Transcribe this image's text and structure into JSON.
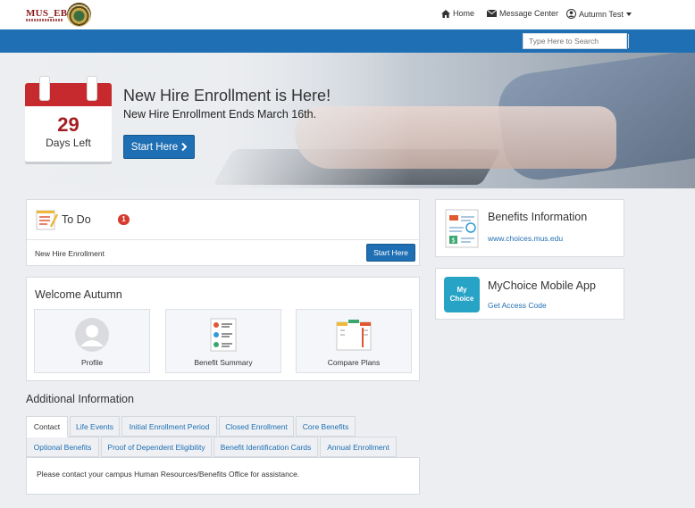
{
  "brand": {
    "logo_text": "MUS_EB"
  },
  "nav": {
    "home": "Home",
    "messages": "Message Center",
    "user": "Autumn Test"
  },
  "search": {
    "placeholder": "Type Here to Search",
    "value": "Type Here to Search"
  },
  "hero": {
    "days_count": "29",
    "days_label": "Days Left",
    "title": "New Hire Enrollment is Here!",
    "subtitle": "New Hire Enrollment Ends March 16th.",
    "button": "Start Here"
  },
  "todo": {
    "title": "To Do",
    "count": "1",
    "item": "New Hire Enrollment",
    "button": "Start Here"
  },
  "welcome": {
    "title": "Welcome Autumn",
    "tiles": [
      {
        "label": "Profile"
      },
      {
        "label": "Benefit Summary"
      },
      {
        "label": "Compare Plans"
      }
    ]
  },
  "sidebar": {
    "benefits": {
      "title": "Benefits Information",
      "link": "www.choices.mus.edu"
    },
    "mobile": {
      "title": "MyChoice Mobile App",
      "link": "Get Access Code",
      "app_icon_top": "My",
      "app_icon_bottom": "Choice"
    }
  },
  "additional": {
    "title": "Additional Information",
    "tabs_row1": [
      "Contact",
      "Life Events",
      "Initial Enrollment Period",
      "Closed Enrollment",
      "Core Benefits"
    ],
    "tabs_row2": [
      "Optional Benefits",
      "Proof of Dependent Eligibility",
      "Benefit Identification Cards",
      "Annual Enrollment"
    ],
    "active_tab": "Contact",
    "panel_text": "Please contact your campus Human Resources/Benefits Office for assistance."
  },
  "colors": {
    "primary": "#1f6fb4",
    "calendar_red": "#c72a2e",
    "badge": "#d63a2f",
    "app_icon": "#27a3c6"
  }
}
